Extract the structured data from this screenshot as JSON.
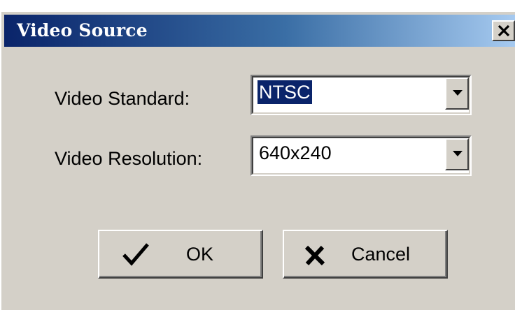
{
  "dialog": {
    "title": "Video Source",
    "close_icon": "close-x-icon"
  },
  "fields": {
    "standard": {
      "label": "Video Standard:",
      "value": "NTSC",
      "selected": true
    },
    "resolution": {
      "label": "Video Resolution:",
      "value": "640x240",
      "selected": false
    }
  },
  "buttons": {
    "ok": {
      "label": "OK",
      "icon": "checkmark-icon"
    },
    "cancel": {
      "label": "Cancel",
      "icon": "x-mark-icon"
    }
  },
  "colors": {
    "title_start": "#0a246a",
    "title_end": "#a6caf0",
    "dialog_face": "#d4d0c8",
    "selection": "#0a246a"
  }
}
